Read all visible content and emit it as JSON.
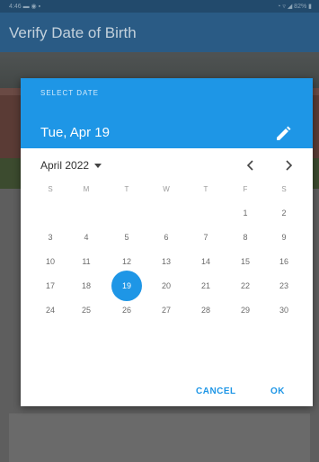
{
  "status_bar": {
    "left": "4:46 ▬ ◉ ▪",
    "right": "◔ ▿ ◢ 82% ▮"
  },
  "app_bar": {
    "title": "Verify Date of Birth"
  },
  "dialog": {
    "header_label": "SELECT DATE",
    "header_date": "Tue, Apr 19",
    "edit_icon": "pencil-icon",
    "month_year": "April 2022",
    "prev_icon": "chevron-left-icon",
    "next_icon": "chevron-right-icon",
    "weekdays": [
      "S",
      "M",
      "T",
      "W",
      "T",
      "F",
      "S"
    ],
    "weeks": [
      [
        "",
        "",
        "",
        "",
        "",
        "1",
        "2"
      ],
      [
        "3",
        "4",
        "5",
        "6",
        "7",
        "8",
        "9"
      ],
      [
        "10",
        "11",
        "12",
        "13",
        "14",
        "15",
        "16"
      ],
      [
        "17",
        "18",
        "19",
        "20",
        "21",
        "22",
        "23"
      ],
      [
        "24",
        "25",
        "26",
        "27",
        "28",
        "29",
        "30"
      ]
    ],
    "selected_day": "19",
    "cancel_label": "CANCEL",
    "ok_label": "OK",
    "accent_color": "#1e96e6"
  }
}
